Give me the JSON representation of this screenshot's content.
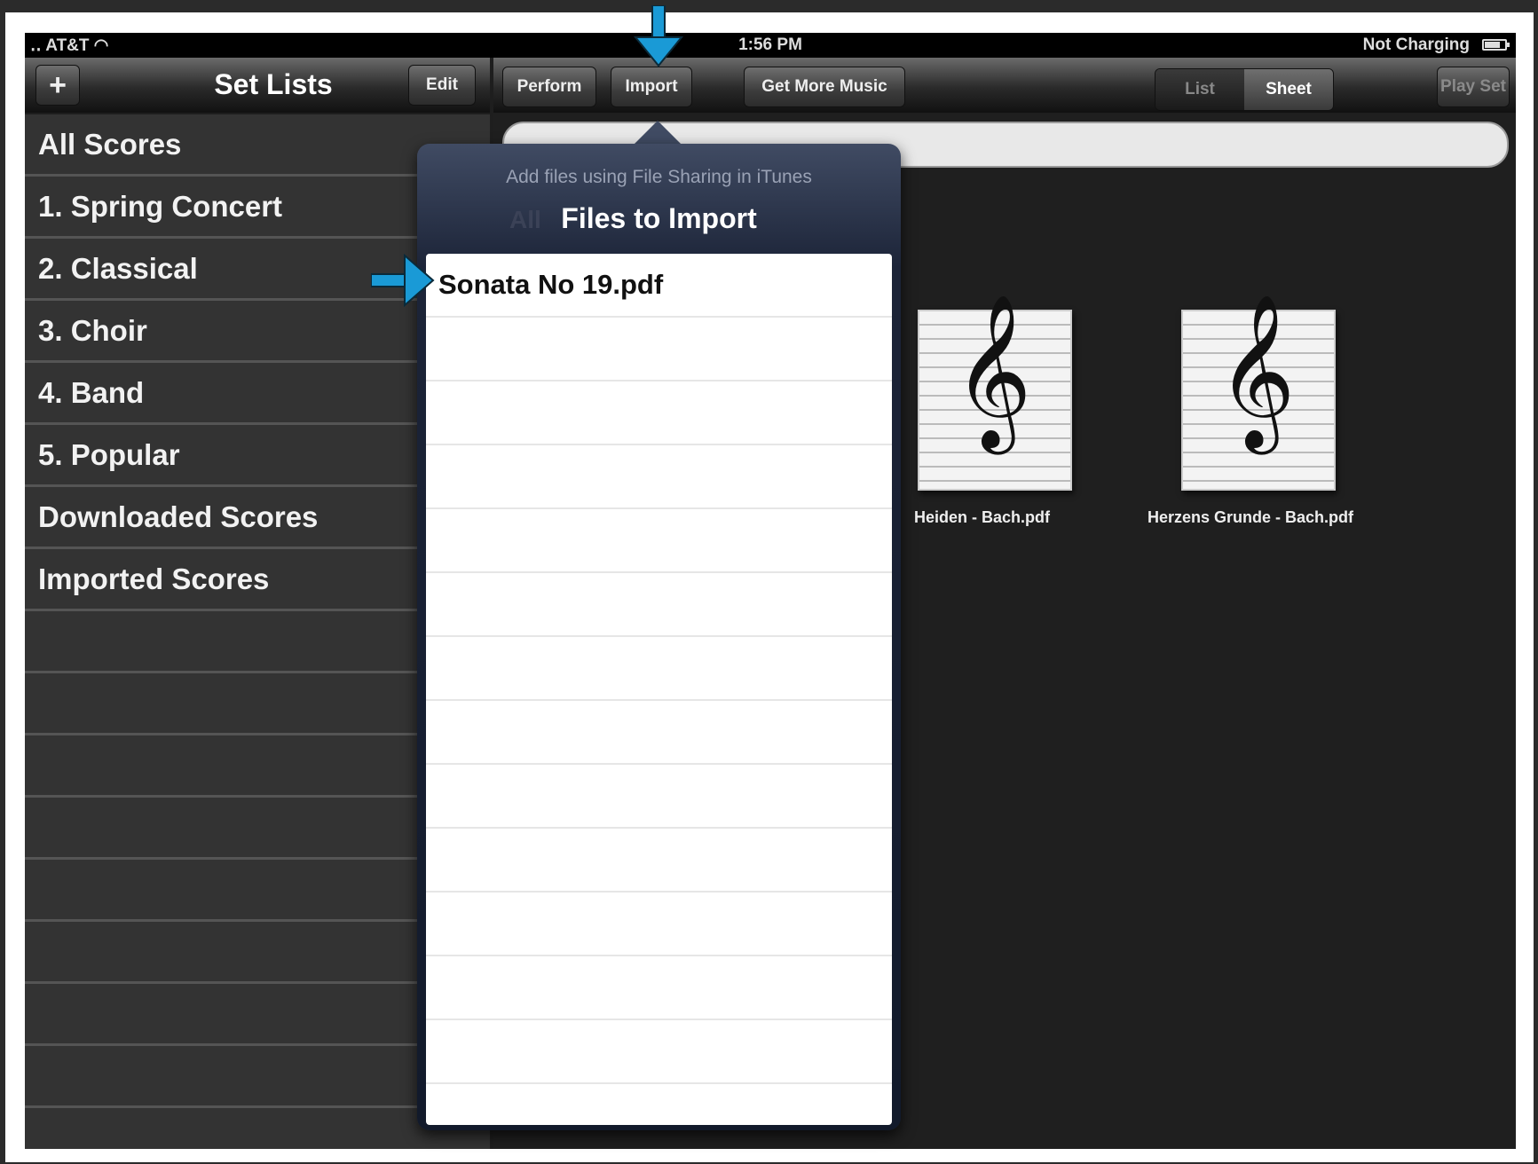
{
  "status_bar": {
    "carrier": "‥ AT&T ◠",
    "time": "1:56 PM",
    "battery_text": "Not Charging"
  },
  "left_toolbar": {
    "add_label": "+",
    "title": "Set Lists",
    "edit_label": "Edit"
  },
  "right_toolbar": {
    "perform_label": "Perform",
    "import_label": "Import",
    "get_more_label": "Get More Music",
    "view_list_label": "List",
    "view_sheet_label": "Sheet",
    "play_set_label": "Play Set"
  },
  "sidebar": {
    "items": [
      {
        "label": "All Scores"
      },
      {
        "label": "1. Spring Concert"
      },
      {
        "label": "2. Classical"
      },
      {
        "label": "3. Choir"
      },
      {
        "label": "4. Band"
      },
      {
        "label": "5. Popular"
      },
      {
        "label": "Downloaded Scores"
      },
      {
        "label": "Imported Scores"
      }
    ]
  },
  "scores": [
    {
      "label": "Heiden - Bach.pdf"
    },
    {
      "label": "Herzens Grunde - Bach.pdf"
    }
  ],
  "popover": {
    "hint": "Add files using File Sharing in iTunes",
    "ghost": "All",
    "title": "Files to Import",
    "files": [
      {
        "label": "Sonata No 19.pdf"
      }
    ]
  },
  "colors": {
    "annotation_arrow": "#1a9ad6",
    "popover_header": "#1c2438"
  }
}
